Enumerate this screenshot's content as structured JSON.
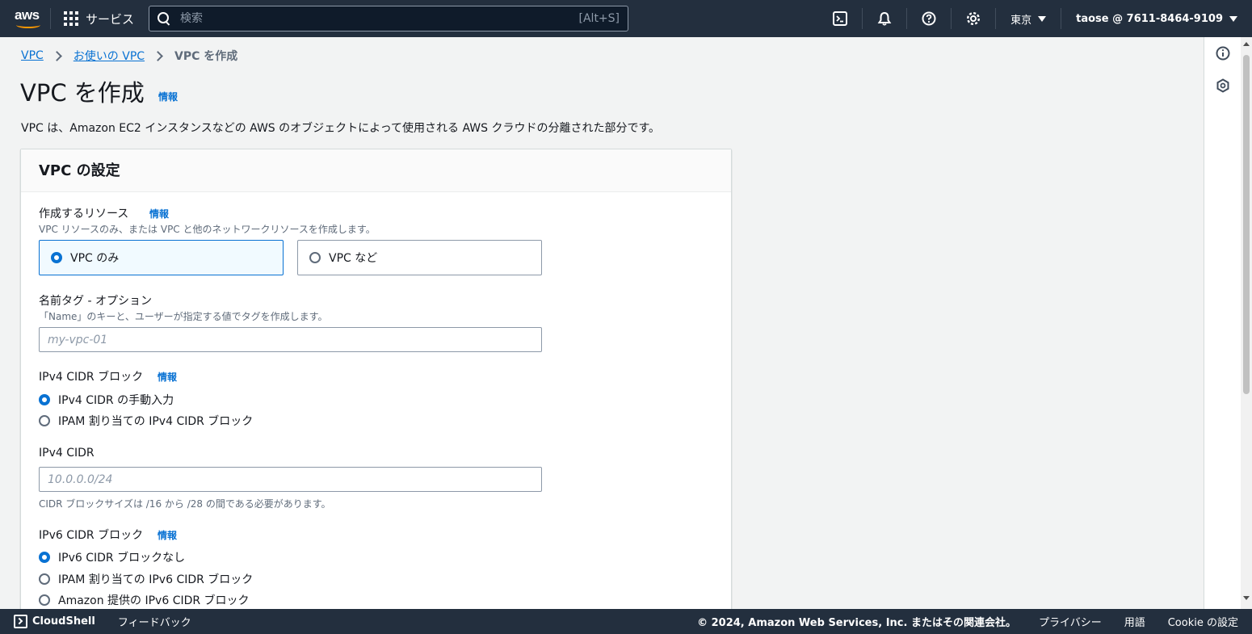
{
  "topnav": {
    "logo": "aws",
    "services_label": "サービス",
    "search_placeholder": "検索",
    "search_hint": "[Alt+S]",
    "region": "東京",
    "account": "taose @ 7611-8464-9109",
    "icons": [
      "cloudshell-icon",
      "notification-bell-icon",
      "help-icon",
      "settings-gear-icon"
    ]
  },
  "breadcrumb": {
    "items": [
      "VPC",
      "お使いの VPC"
    ],
    "current": "VPC を作成"
  },
  "page": {
    "title": "VPC を作成",
    "info": "情報",
    "description": "VPC は、Amazon EC2 インスタンスなどの AWS のオブジェクトによって使用される AWS クラウドの分離された部分です。"
  },
  "panel": {
    "title": "VPC の設定",
    "resources": {
      "label": "作成するリソース",
      "info": "情報",
      "description": "VPC リソースのみ、または VPC と他のネットワークリソースを作成します。",
      "options": [
        "VPC のみ",
        "VPC など"
      ],
      "selected": "VPC のみ"
    },
    "name_tag": {
      "label": "名前タグ - オプション",
      "description": "「Name」のキーと、ユーザーが指定する値でタグを作成します。",
      "value": "",
      "placeholder": "my-vpc-01"
    },
    "ipv4_block": {
      "label": "IPv4 CIDR ブロック",
      "info": "情報",
      "options": [
        "IPv4 CIDR の手動入力",
        "IPAM 割り当ての IPv4 CIDR ブロック"
      ],
      "selected": "IPv4 CIDR の手動入力"
    },
    "ipv4_cidr": {
      "label": "IPv4 CIDR",
      "value": "",
      "placeholder": "10.0.0.0/24",
      "hint": "CIDR ブロックサイズは /16 から /28 の間である必要があります。"
    },
    "ipv6_block": {
      "label": "IPv6 CIDR ブロック",
      "info": "情報",
      "options": [
        "IPv6 CIDR ブロックなし",
        "IPAM 割り当ての IPv6 CIDR ブロック",
        "Amazon 提供の IPv6 CIDR ブロック"
      ],
      "selected": "IPv6 CIDR ブロックなし"
    }
  },
  "footer": {
    "cloudshell": "CloudShell",
    "feedback": "フィードバック",
    "copyright": "© 2024, Amazon Web Services, Inc. またはその関連会社。",
    "privacy": "プライバシー",
    "terms": "用語",
    "cookie": "Cookie の設定"
  },
  "colors": {
    "nav_bg": "#232f3e",
    "accent": "#0972d3",
    "aws_orange": "#ff9900"
  }
}
